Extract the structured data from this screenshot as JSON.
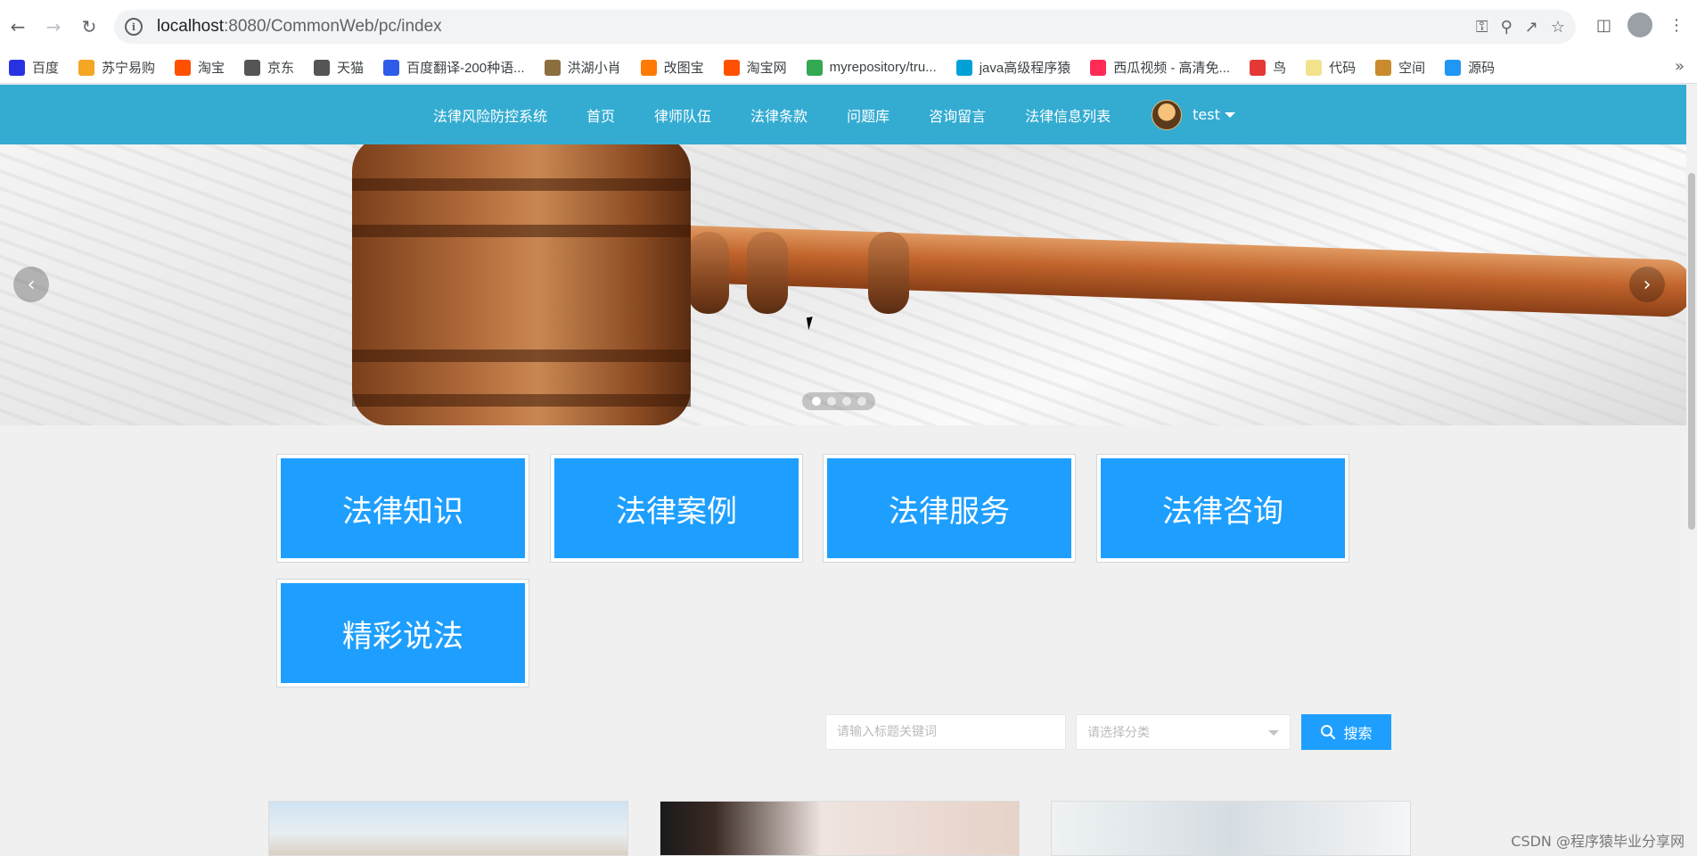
{
  "browser": {
    "url_host": "localhost",
    "url_rest": ":8080/CommonWeb/pc/index",
    "bookmarks": [
      {
        "label": "百度",
        "color": "#2932e1"
      },
      {
        "label": "苏宁易购",
        "color": "#f5a623"
      },
      {
        "label": "淘宝",
        "color": "#ff5000"
      },
      {
        "label": "京东",
        "color": "#555555"
      },
      {
        "label": "天猫",
        "color": "#555555"
      },
      {
        "label": "百度翻译-200种语...",
        "color": "#2f5bea"
      },
      {
        "label": "洪湖小肖",
        "color": "#8b6f3e"
      },
      {
        "label": "改图宝",
        "color": "#ff7a00"
      },
      {
        "label": "淘宝网",
        "color": "#ff5000"
      },
      {
        "label": "myrepository/tru...",
        "color": "#34a853"
      },
      {
        "label": "java高级程序猿",
        "color": "#00a1d6"
      },
      {
        "label": "西瓜视频 - 高清免...",
        "color": "#fe2c55"
      },
      {
        "label": "鸟",
        "color": "#e53935"
      },
      {
        "label": "代码",
        "color": "#f2e28c"
      },
      {
        "label": "空间",
        "color": "#c98b2b"
      },
      {
        "label": "源码",
        "color": "#2196f3"
      }
    ]
  },
  "nav": {
    "items": [
      "法律风险防控系统",
      "首页",
      "律师队伍",
      "法律条款",
      "问题库",
      "咨询留言",
      "法律信息列表"
    ],
    "user": "test"
  },
  "carousel": {
    "slide_count": 4,
    "active_index": 0
  },
  "tiles": [
    "法律知识",
    "法律案例",
    "法律服务",
    "法律咨询",
    "精彩说法"
  ],
  "search": {
    "placeholder": "请输入标题关键词",
    "category_placeholder": "请选择分类",
    "button_label": "搜索"
  },
  "watermark": "CSDN @程序猿毕业分享网",
  "colors": {
    "nav_bg": "#34acd2",
    "tile_bg": "#1e9fff",
    "button_bg": "#1e9fff"
  }
}
